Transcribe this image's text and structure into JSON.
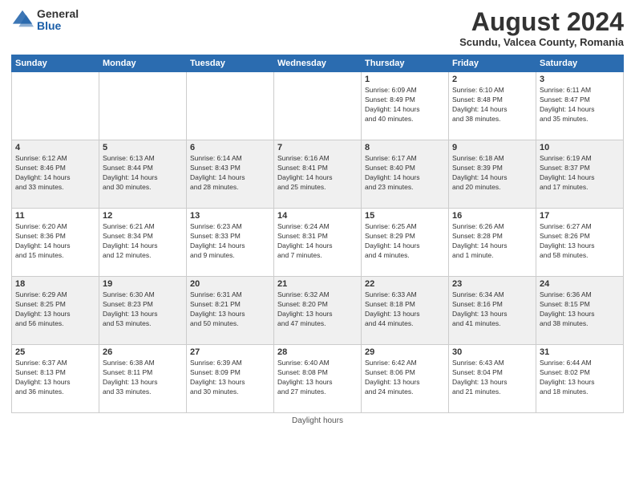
{
  "header": {
    "logo_general": "General",
    "logo_blue": "Blue",
    "month_year": "August 2024",
    "location": "Scundu, Valcea County, Romania"
  },
  "weekdays": [
    "Sunday",
    "Monday",
    "Tuesday",
    "Wednesday",
    "Thursday",
    "Friday",
    "Saturday"
  ],
  "footer": {
    "note": "Daylight hours"
  },
  "weeks": [
    [
      {
        "day": "",
        "info": ""
      },
      {
        "day": "",
        "info": ""
      },
      {
        "day": "",
        "info": ""
      },
      {
        "day": "",
        "info": ""
      },
      {
        "day": "1",
        "info": "Sunrise: 6:09 AM\nSunset: 8:49 PM\nDaylight: 14 hours\nand 40 minutes."
      },
      {
        "day": "2",
        "info": "Sunrise: 6:10 AM\nSunset: 8:48 PM\nDaylight: 14 hours\nand 38 minutes."
      },
      {
        "day": "3",
        "info": "Sunrise: 6:11 AM\nSunset: 8:47 PM\nDaylight: 14 hours\nand 35 minutes."
      }
    ],
    [
      {
        "day": "4",
        "info": "Sunrise: 6:12 AM\nSunset: 8:46 PM\nDaylight: 14 hours\nand 33 minutes."
      },
      {
        "day": "5",
        "info": "Sunrise: 6:13 AM\nSunset: 8:44 PM\nDaylight: 14 hours\nand 30 minutes."
      },
      {
        "day": "6",
        "info": "Sunrise: 6:14 AM\nSunset: 8:43 PM\nDaylight: 14 hours\nand 28 minutes."
      },
      {
        "day": "7",
        "info": "Sunrise: 6:16 AM\nSunset: 8:41 PM\nDaylight: 14 hours\nand 25 minutes."
      },
      {
        "day": "8",
        "info": "Sunrise: 6:17 AM\nSunset: 8:40 PM\nDaylight: 14 hours\nand 23 minutes."
      },
      {
        "day": "9",
        "info": "Sunrise: 6:18 AM\nSunset: 8:39 PM\nDaylight: 14 hours\nand 20 minutes."
      },
      {
        "day": "10",
        "info": "Sunrise: 6:19 AM\nSunset: 8:37 PM\nDaylight: 14 hours\nand 17 minutes."
      }
    ],
    [
      {
        "day": "11",
        "info": "Sunrise: 6:20 AM\nSunset: 8:36 PM\nDaylight: 14 hours\nand 15 minutes."
      },
      {
        "day": "12",
        "info": "Sunrise: 6:21 AM\nSunset: 8:34 PM\nDaylight: 14 hours\nand 12 minutes."
      },
      {
        "day": "13",
        "info": "Sunrise: 6:23 AM\nSunset: 8:33 PM\nDaylight: 14 hours\nand 9 minutes."
      },
      {
        "day": "14",
        "info": "Sunrise: 6:24 AM\nSunset: 8:31 PM\nDaylight: 14 hours\nand 7 minutes."
      },
      {
        "day": "15",
        "info": "Sunrise: 6:25 AM\nSunset: 8:29 PM\nDaylight: 14 hours\nand 4 minutes."
      },
      {
        "day": "16",
        "info": "Sunrise: 6:26 AM\nSunset: 8:28 PM\nDaylight: 14 hours\nand 1 minute."
      },
      {
        "day": "17",
        "info": "Sunrise: 6:27 AM\nSunset: 8:26 PM\nDaylight: 13 hours\nand 58 minutes."
      }
    ],
    [
      {
        "day": "18",
        "info": "Sunrise: 6:29 AM\nSunset: 8:25 PM\nDaylight: 13 hours\nand 56 minutes."
      },
      {
        "day": "19",
        "info": "Sunrise: 6:30 AM\nSunset: 8:23 PM\nDaylight: 13 hours\nand 53 minutes."
      },
      {
        "day": "20",
        "info": "Sunrise: 6:31 AM\nSunset: 8:21 PM\nDaylight: 13 hours\nand 50 minutes."
      },
      {
        "day": "21",
        "info": "Sunrise: 6:32 AM\nSunset: 8:20 PM\nDaylight: 13 hours\nand 47 minutes."
      },
      {
        "day": "22",
        "info": "Sunrise: 6:33 AM\nSunset: 8:18 PM\nDaylight: 13 hours\nand 44 minutes."
      },
      {
        "day": "23",
        "info": "Sunrise: 6:34 AM\nSunset: 8:16 PM\nDaylight: 13 hours\nand 41 minutes."
      },
      {
        "day": "24",
        "info": "Sunrise: 6:36 AM\nSunset: 8:15 PM\nDaylight: 13 hours\nand 38 minutes."
      }
    ],
    [
      {
        "day": "25",
        "info": "Sunrise: 6:37 AM\nSunset: 8:13 PM\nDaylight: 13 hours\nand 36 minutes."
      },
      {
        "day": "26",
        "info": "Sunrise: 6:38 AM\nSunset: 8:11 PM\nDaylight: 13 hours\nand 33 minutes."
      },
      {
        "day": "27",
        "info": "Sunrise: 6:39 AM\nSunset: 8:09 PM\nDaylight: 13 hours\nand 30 minutes."
      },
      {
        "day": "28",
        "info": "Sunrise: 6:40 AM\nSunset: 8:08 PM\nDaylight: 13 hours\nand 27 minutes."
      },
      {
        "day": "29",
        "info": "Sunrise: 6:42 AM\nSunset: 8:06 PM\nDaylight: 13 hours\nand 24 minutes."
      },
      {
        "day": "30",
        "info": "Sunrise: 6:43 AM\nSunset: 8:04 PM\nDaylight: 13 hours\nand 21 minutes."
      },
      {
        "day": "31",
        "info": "Sunrise: 6:44 AM\nSunset: 8:02 PM\nDaylight: 13 hours\nand 18 minutes."
      }
    ]
  ]
}
